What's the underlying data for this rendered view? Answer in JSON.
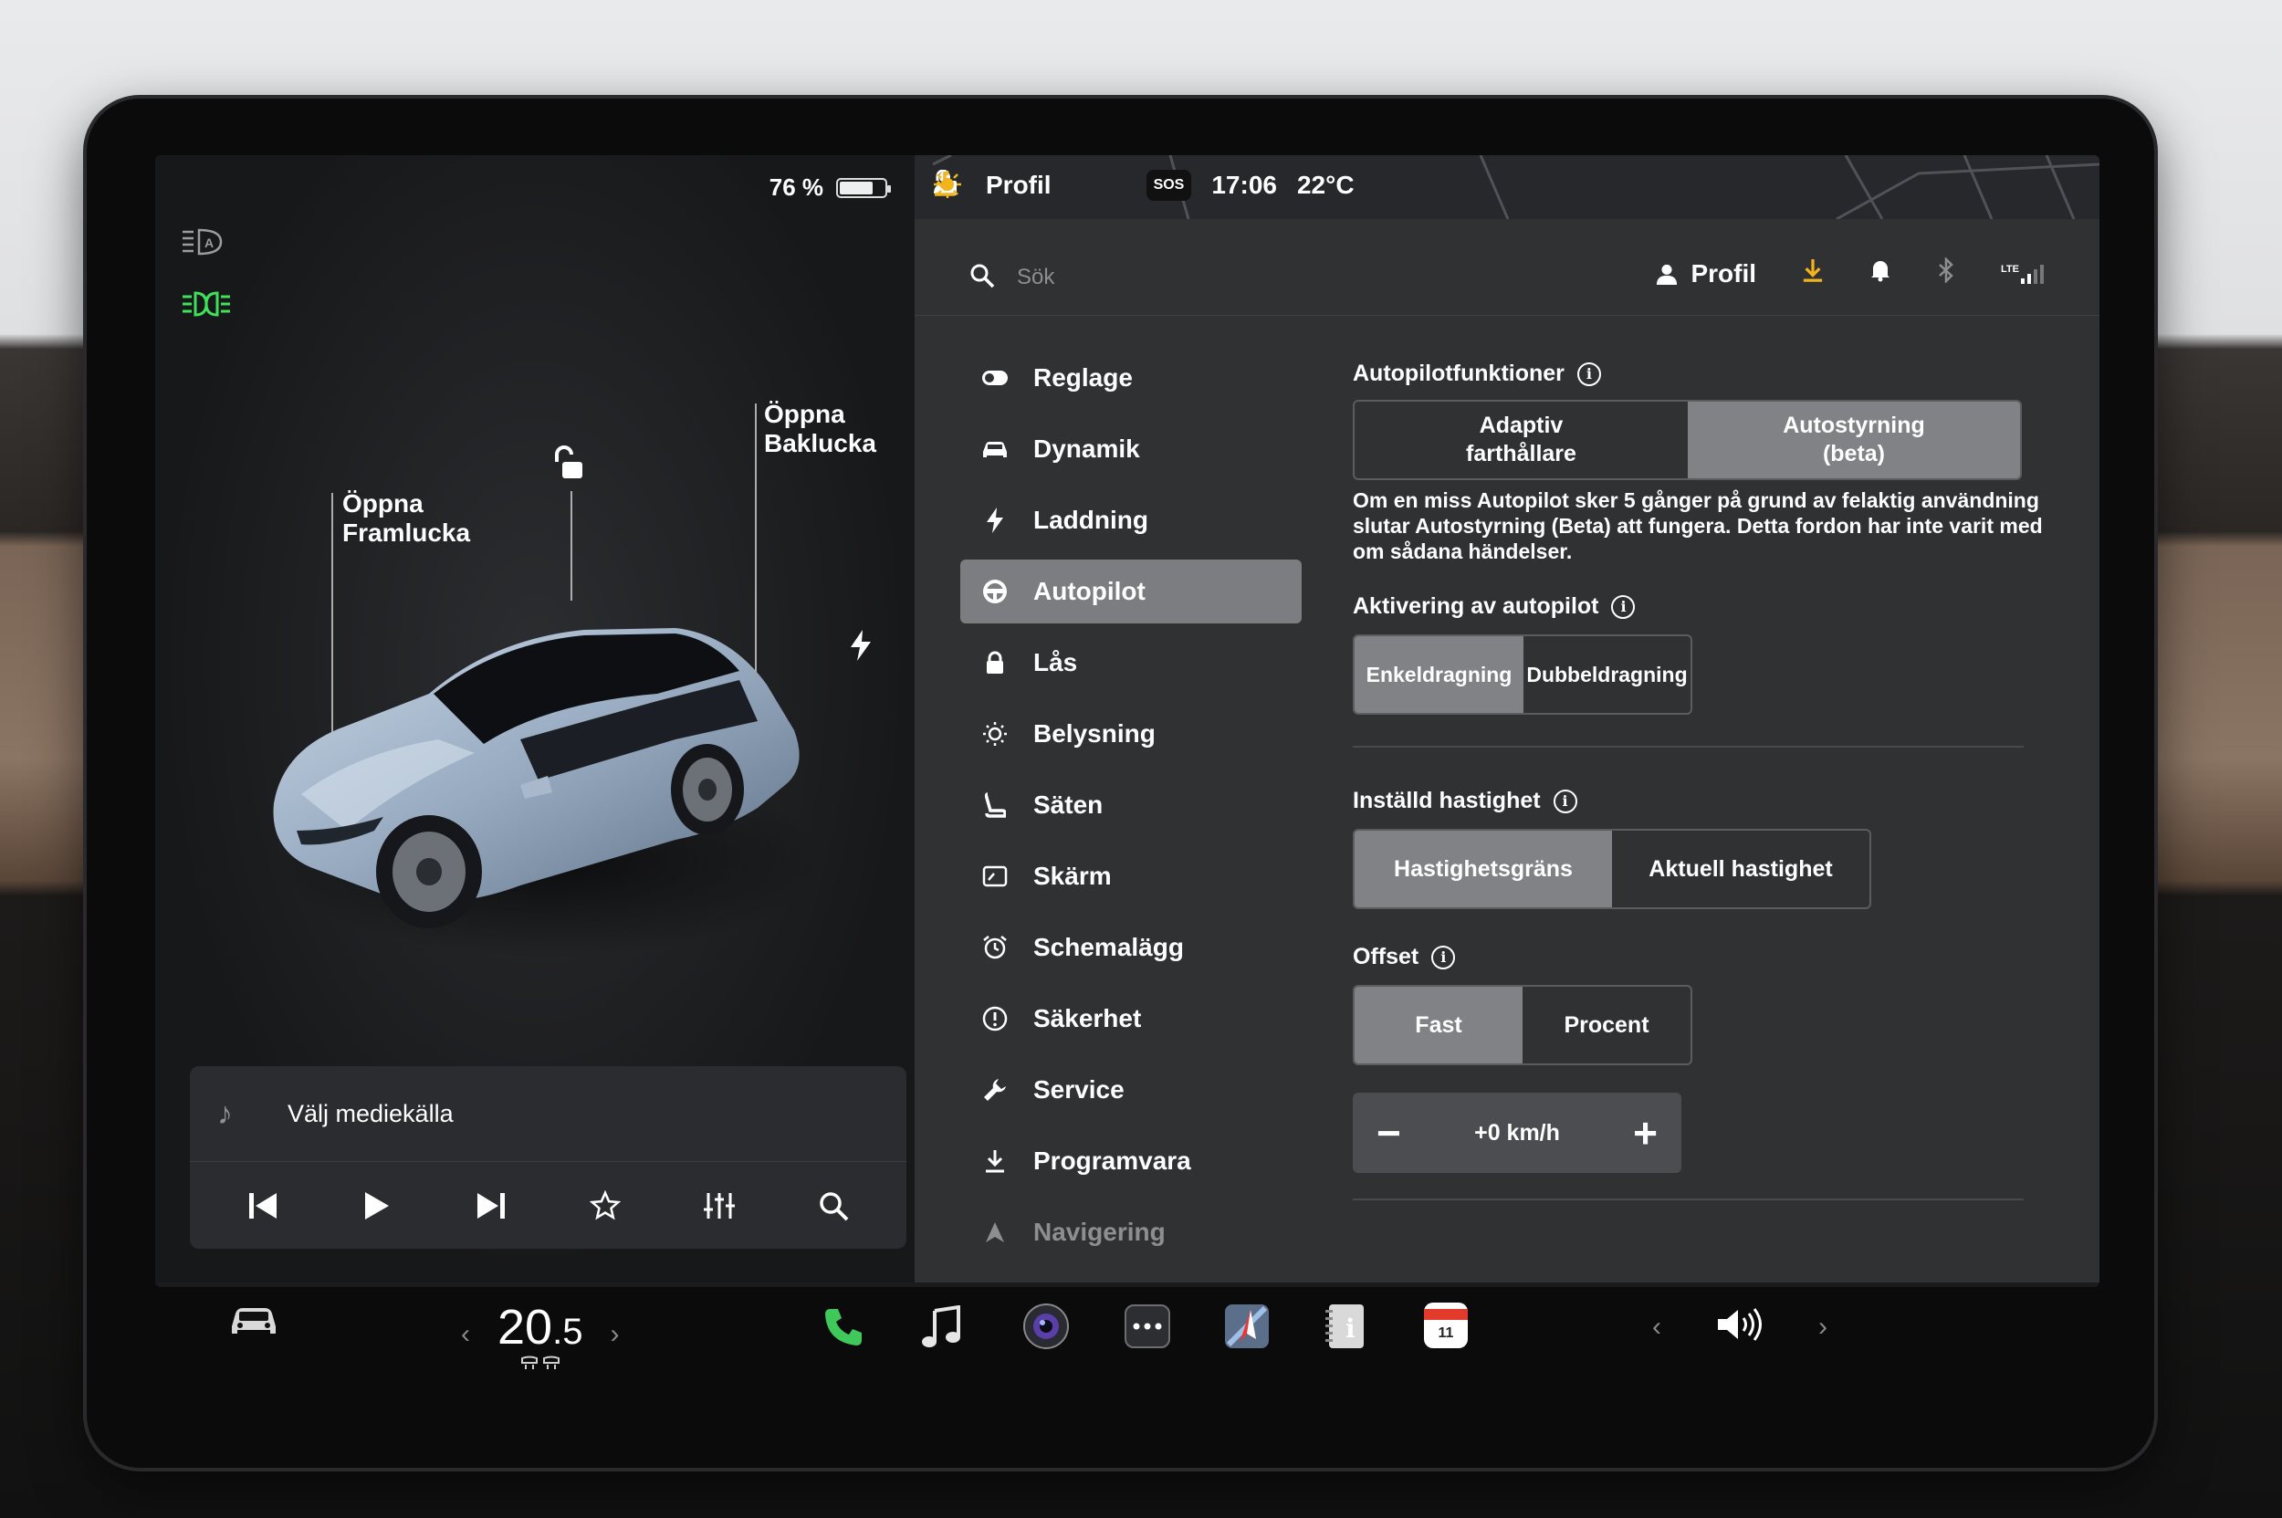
{
  "status": {
    "battery_percent": "76 %",
    "battery_level": 0.76,
    "time": "17:06",
    "temperature": "22°C",
    "profile": "Profil",
    "sos": "SOS"
  },
  "car": {
    "front_trunk_label": [
      "Öppna",
      "Framlucka"
    ],
    "rear_trunk_label": [
      "Öppna",
      "Baklucka"
    ]
  },
  "media": {
    "source_label": "Välj mediekälla",
    "controls": [
      "previous-icon",
      "play-icon",
      "next-icon",
      "star-icon",
      "equalizer-icon",
      "search-icon"
    ]
  },
  "header": {
    "search_placeholder": "Sök",
    "profile": "Profil",
    "lte": "LTE"
  },
  "nav": {
    "items": [
      {
        "label": "Reglage",
        "icon": "toggle-icon"
      },
      {
        "label": "Dynamik",
        "icon": "car-icon"
      },
      {
        "label": "Laddning",
        "icon": "bolt-icon"
      },
      {
        "label": "Autopilot",
        "icon": "steering-wheel-icon"
      },
      {
        "label": "Lås",
        "icon": "lock-icon"
      },
      {
        "label": "Belysning",
        "icon": "sun-icon"
      },
      {
        "label": "Säten",
        "icon": "seat-icon"
      },
      {
        "label": "Skärm",
        "icon": "display-icon"
      },
      {
        "label": "Schemalägg",
        "icon": "alarm-icon"
      },
      {
        "label": "Säkerhet",
        "icon": "alert-icon"
      },
      {
        "label": "Service",
        "icon": "wrench-icon"
      },
      {
        "label": "Programvara",
        "icon": "download-icon"
      },
      {
        "label": "Navigering",
        "icon": "navigation-icon"
      }
    ],
    "active": "Autopilot"
  },
  "autopilot": {
    "features_title": "Autopilotfunktioner",
    "features_options": [
      "Adaptiv\nfarthållare",
      "Autostyrning\n(beta)"
    ],
    "features_selected": 1,
    "warning_text": "Om en miss Autopilot sker 5 gånger på grund av felaktig användning slutar Autostyrning (Beta) att fungera. Detta fordon har inte varit med om sådana händelser.",
    "activation_title": "Aktivering av autopilot",
    "activation_options": [
      "Enkeldragning",
      "Dubbeldragning"
    ],
    "activation_selected": 0,
    "speed_title": "Inställd hastighet",
    "speed_options": [
      "Hastighetsgräns",
      "Aktuell hastighet"
    ],
    "speed_selected": 0,
    "offset_title": "Offset",
    "offset_options": [
      "Fast",
      "Procent"
    ],
    "offset_selected": 0,
    "offset_value": "+0 km/h",
    "minus": "−",
    "plus": "+"
  },
  "dock": {
    "temperature_main": "20",
    "temperature_decimal": ".5",
    "calendar_day": "11"
  }
}
